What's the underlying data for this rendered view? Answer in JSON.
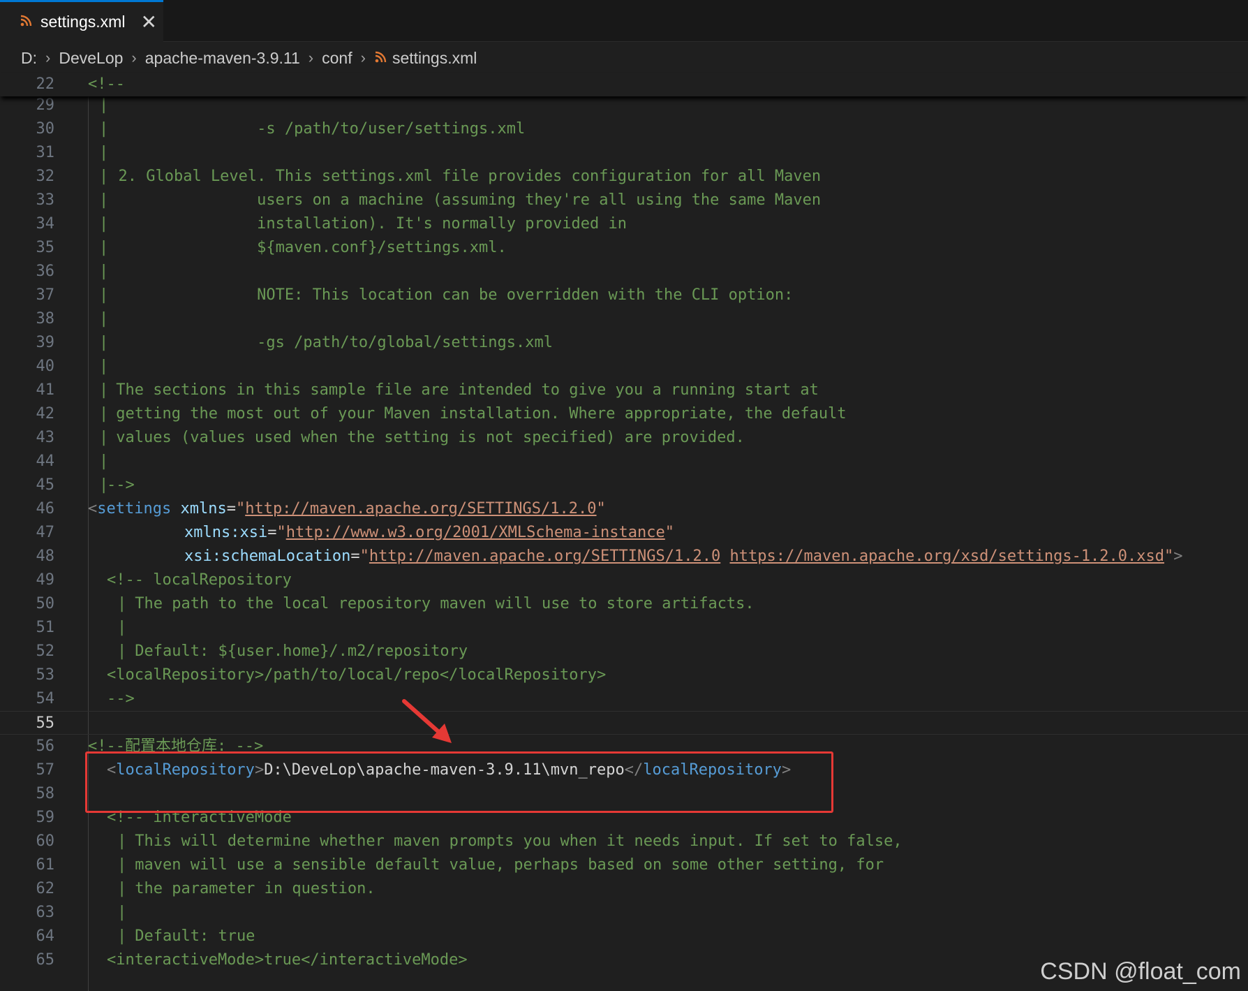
{
  "tab": {
    "label": "settings.xml",
    "close": "✕",
    "icon": "rss-icon"
  },
  "breadcrumb": [
    "D:",
    "DeveLop",
    "apache-maven-3.9.11",
    "conf",
    "settings.xml"
  ],
  "sticky": {
    "number": "22",
    "text": "<!--"
  },
  "lines": {
    "l29": {
      "n": "29",
      "t": ""
    },
    "l30": {
      "n": "30",
      "t": "                 -s /path/to/user/settings.xml"
    },
    "l31": {
      "n": "31",
      "t": ""
    },
    "l32": {
      "n": "32",
      "t": "  2. Global Level. This settings.xml file provides configuration for all Maven"
    },
    "l33": {
      "n": "33",
      "t": "                 users on a machine (assuming they're all using the same Maven"
    },
    "l34": {
      "n": "34",
      "t": "                 installation). It's normally provided in"
    },
    "l35": {
      "n": "35",
      "t": "                 ${maven.conf}/settings.xml."
    },
    "l36": {
      "n": "36",
      "t": ""
    },
    "l37": {
      "n": "37",
      "t": "                 NOTE: This location can be overridden with the CLI option:"
    },
    "l38": {
      "n": "38",
      "t": ""
    },
    "l39": {
      "n": "39",
      "t": "                 -gs /path/to/global/settings.xml"
    },
    "l40": {
      "n": "40",
      "t": ""
    },
    "l41": {
      "n": "41",
      "t": " The sections in this sample file are intended to give you a running start at"
    },
    "l42": {
      "n": "42",
      "t": " getting the most out of your Maven installation. Where appropriate, the default"
    },
    "l43": {
      "n": "43",
      "t": " values (values used when the setting is not specified) are provided."
    },
    "l44": {
      "n": "44",
      "t": ""
    },
    "l45": {
      "n": "45",
      "t": "-->"
    },
    "l46": {
      "n": "46",
      "tag": "settings",
      "attr": "xmlns",
      "url": "http://maven.apache.org/SETTINGS/1.2.0"
    },
    "l47": {
      "n": "47",
      "attr": "xmlns:xsi",
      "url": "http://www.w3.org/2001/XMLSchema-instance"
    },
    "l48": {
      "n": "48",
      "attr": "xsi:schemaLocation",
      "url1": "http://maven.apache.org/SETTINGS/1.2.0",
      "url2": "https://maven.apache.org/xsd/settings-1.2.0.xsd"
    },
    "l49": {
      "n": "49",
      "t": "<!-- localRepository"
    },
    "l50": {
      "n": "50",
      "t": " The path to the local repository maven will use to store artifacts."
    },
    "l51": {
      "n": "51",
      "t": ""
    },
    "l52": {
      "n": "52",
      "t": " Default: ${user.home}/.m2/repository"
    },
    "l53": {
      "n": "53",
      "t": "<localRepository>/path/to/local/repo</localRepository>"
    },
    "l54": {
      "n": "54",
      "t": "-->"
    },
    "l55": {
      "n": "55",
      "t": ""
    },
    "l56": {
      "n": "56",
      "t": "<!--配置本地仓库: -->"
    },
    "l57": {
      "n": "57",
      "tag": "localRepository",
      "value": "D:\\DeveLop\\apache-maven-3.9.11\\mvn_repo"
    },
    "l58": {
      "n": "58",
      "t": ""
    },
    "l59": {
      "n": "59",
      "t": "<!-- interactiveMode"
    },
    "l60": {
      "n": "60",
      "t": " This will determine whether maven prompts you when it needs input. If set to false,"
    },
    "l61": {
      "n": "61",
      "t": " maven will use a sensible default value, perhaps based on some other setting, for"
    },
    "l62": {
      "n": "62",
      "t": " the parameter in question."
    },
    "l63": {
      "n": "63",
      "t": ""
    },
    "l64": {
      "n": "64",
      "t": " Default: true"
    },
    "l65": {
      "n": "65",
      "t": "<interactiveMode>true</interactiveMode>"
    }
  },
  "watermark": "CSDN @float_com",
  "colors": {
    "accent": "#0078d4",
    "annotation": "#e53935",
    "comment": "#6a9955",
    "tag": "#569cd6",
    "string": "#ce9178"
  }
}
